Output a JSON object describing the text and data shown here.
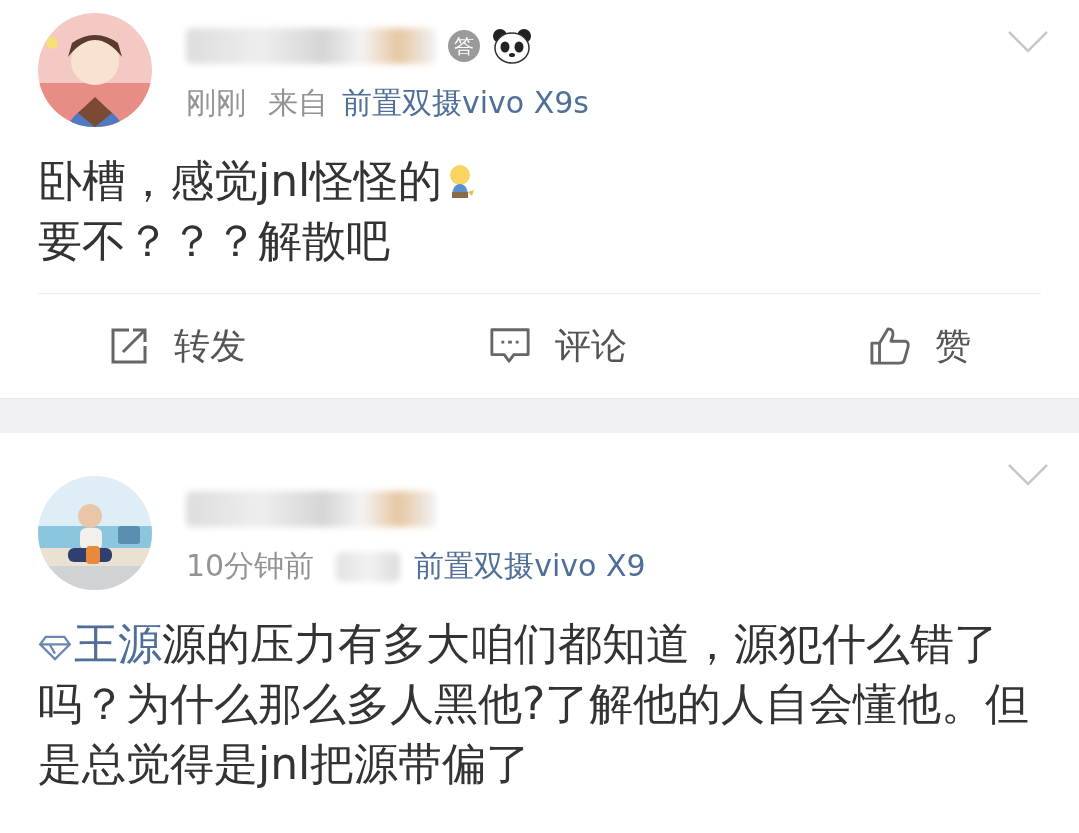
{
  "posts": [
    {
      "avatar": {
        "kind": "picture"
      },
      "badges": [
        {
          "kind": "medal",
          "label": "答"
        },
        {
          "kind": "panda"
        }
      ],
      "time": "刚刚",
      "source_prefix": "来自",
      "source": "前置双摄vivo X9s",
      "lines": [
        {
          "text": "卧槽，感觉jnl怪怪的",
          "emoji": true
        },
        {
          "text": "要不？？？解散吧",
          "emoji": false
        }
      ],
      "actions": [
        {
          "kind": "repost",
          "label": "转发"
        },
        {
          "kind": "comment",
          "label": "评论"
        },
        {
          "kind": "like",
          "label": "赞"
        }
      ]
    },
    {
      "avatar": {
        "kind": "picture"
      },
      "time": "10分钟前",
      "source": "前置双摄vivo X9",
      "topic": "王源",
      "body": "源的压力有多大咱们都知道，源犯什么错了吗？为什么那么多人黑他?了解他的人自会懂他。但是总觉得是jnl把源带偏了"
    }
  ]
}
